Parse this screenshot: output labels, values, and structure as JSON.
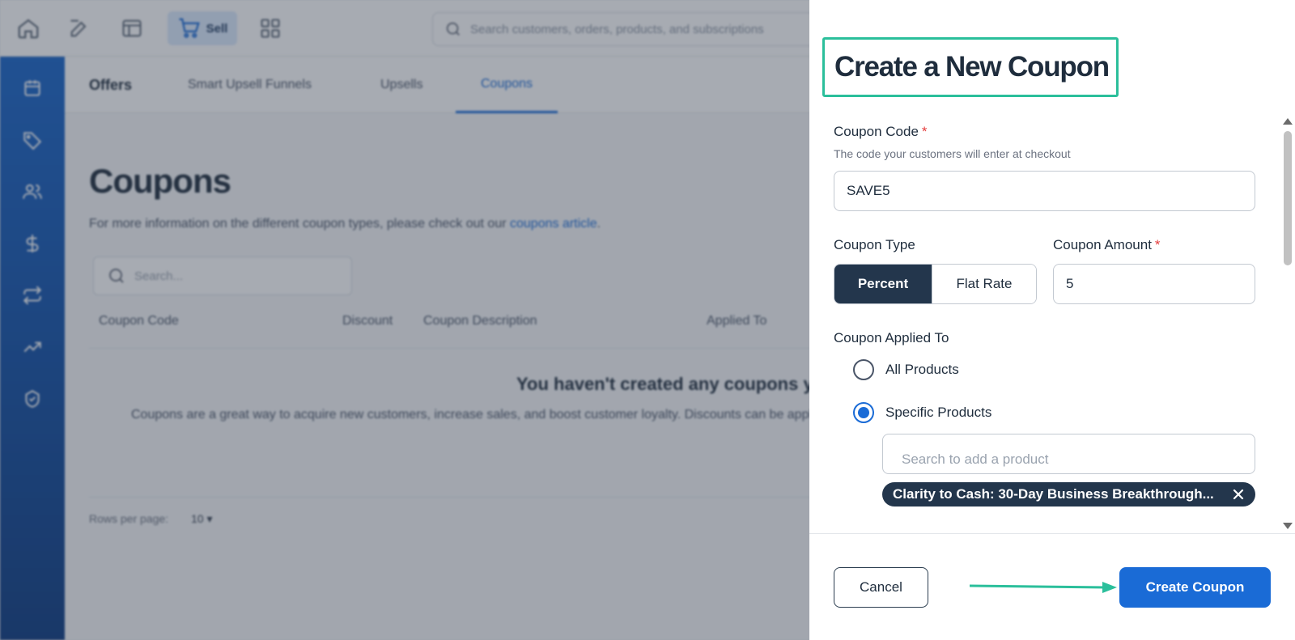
{
  "topbar": {
    "sell_label": "Sell",
    "search_placeholder": "Search customers, orders, products, and subscriptions"
  },
  "subnav": {
    "title": "Offers",
    "tabs": [
      {
        "label": "Smart Upsell Funnels"
      },
      {
        "label": "Upsells"
      },
      {
        "label": "Coupons",
        "active": true
      }
    ]
  },
  "page": {
    "title": "Coupons",
    "subtitle_prefix": "For more information on the different coupon types, please check out our ",
    "subtitle_link": "coupons article",
    "subtitle_suffix": ".",
    "search_placeholder": "Search...",
    "columns": [
      "Coupon Code",
      "Discount",
      "Coupon Description",
      "Applied To"
    ],
    "empty_title": "You haven't created any coupons yet",
    "empty_sub": "Coupons are a great way to acquire new customers, increase sales, and boost customer loyalty. Discounts can be applied to your products.",
    "rows_per_page_label": "Rows per page:",
    "rows_per_page_value": "10"
  },
  "drawer": {
    "title": "Create a New Coupon",
    "coupon_code_label": "Coupon Code",
    "coupon_code_help": "The code your customers will enter at checkout",
    "coupon_code_value": "SAVE5",
    "coupon_type_label": "Coupon Type",
    "coupon_type_options": [
      "Percent",
      "Flat Rate"
    ],
    "coupon_type_selected": "Percent",
    "coupon_amount_label": "Coupon Amount",
    "coupon_amount_value": "5",
    "applied_to_label": "Coupon Applied To",
    "applied_to_options": [
      "All Products",
      "Specific Products"
    ],
    "applied_to_selected": "Specific Products",
    "product_search_placeholder": "Search to add a product",
    "selected_product": "Clarity to Cash: 30-Day Business Breakthrough...",
    "required_marker": "*",
    "cancel_label": "Cancel",
    "create_label": "Create Coupon"
  },
  "colors": {
    "primary": "#1a6bd6",
    "dark": "#23364c",
    "highlight": "#2bbf9b",
    "required": "#e53e3e"
  },
  "icons": [
    "home-icon",
    "edit-icon",
    "layout-icon",
    "cart-icon",
    "grid-icon",
    "search-icon",
    "calendar-icon",
    "tag-icon",
    "users-icon",
    "dollar-icon",
    "repeat-icon",
    "trend-icon",
    "badge-icon",
    "close-icon"
  ]
}
